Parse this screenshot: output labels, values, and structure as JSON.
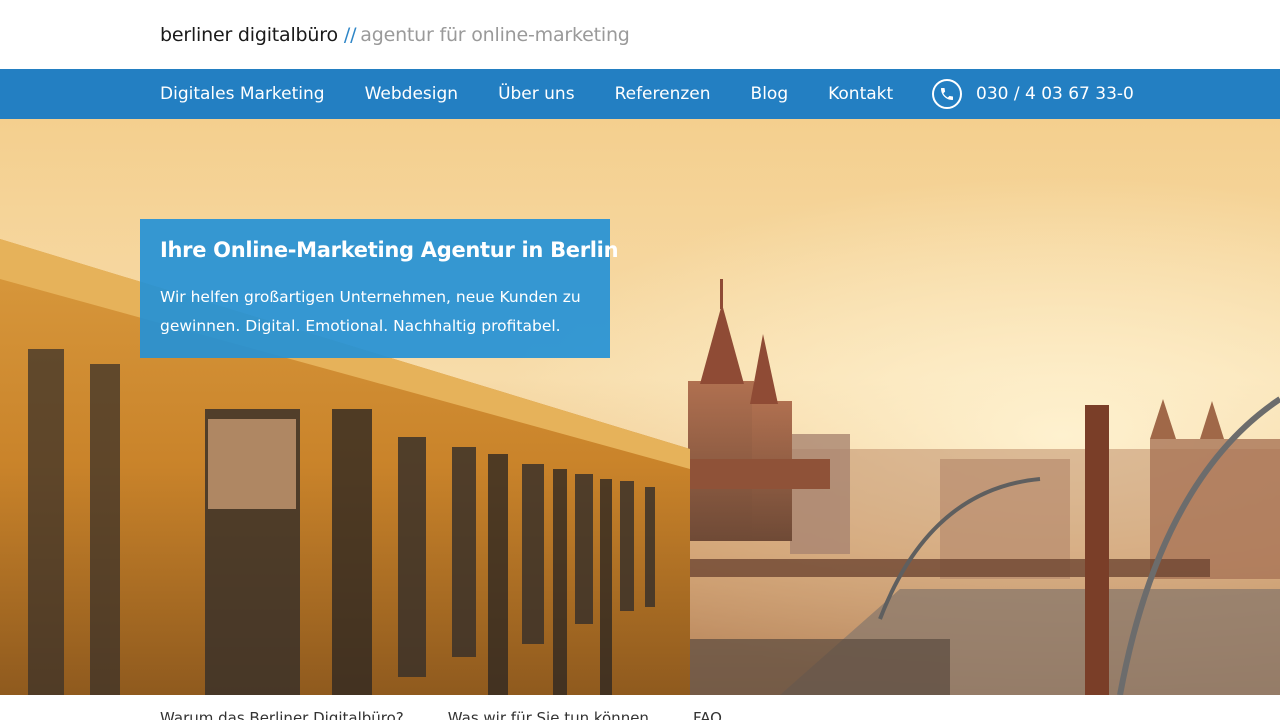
{
  "brand": {
    "name": "berliner digitalbüro",
    "separator": "//",
    "tagline": "agentur für online-marketing"
  },
  "nav": {
    "items": [
      {
        "label": "Digitales Marketing"
      },
      {
        "label": "Webdesign"
      },
      {
        "label": "Über uns"
      },
      {
        "label": "Referenzen"
      },
      {
        "label": "Blog"
      },
      {
        "label": "Kontakt"
      }
    ],
    "phone": {
      "icon": "phone-icon",
      "number": "030 / 4 03 67 33-0"
    }
  },
  "hero": {
    "title": "Ihre Online-Marketing Agentur in Berlin",
    "text": "Wir helfen großartigen Unternehmen, neue Kunden zu gewinnen. Digital. Emotional. Nachhaltig profitabel."
  },
  "subnav": {
    "items": [
      {
        "label": "Warum das Berliner Digitalbüro?"
      },
      {
        "label": "Was wir für Sie tun können"
      },
      {
        "label": "FAQ"
      }
    ]
  },
  "colors": {
    "nav_background": "#237fc2",
    "accent": "#2e86c7",
    "hero_card": "#2491d6"
  }
}
